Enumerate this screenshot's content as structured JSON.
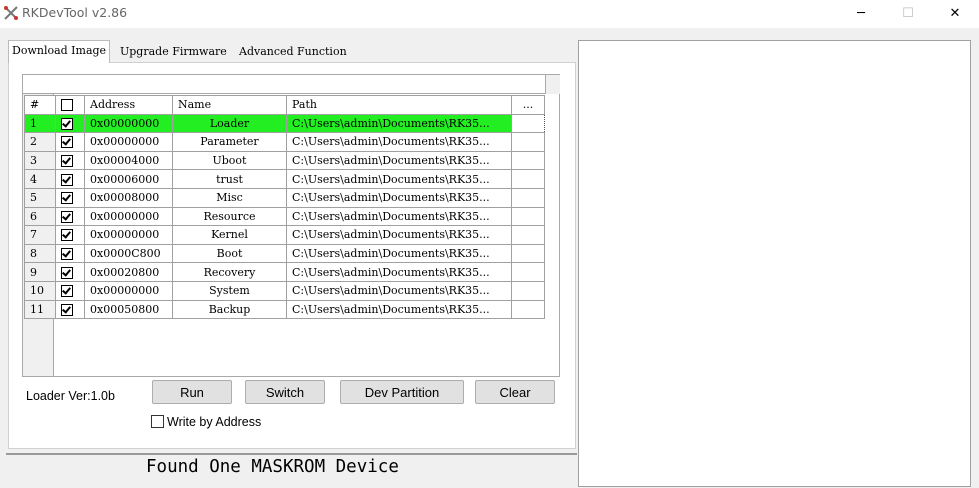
{
  "window": {
    "title": "RKDevTool v2.86",
    "icon": "rk-tool-icon",
    "controls": {
      "minimize": "─",
      "maximize": "☐",
      "close": "✕"
    }
  },
  "tabs": [
    {
      "label": "Download Image",
      "active": true
    },
    {
      "label": "Upgrade Firmware",
      "active": false
    },
    {
      "label": "Advanced Function",
      "active": false
    }
  ],
  "table": {
    "headers": {
      "num": "#",
      "check": "",
      "address": "Address",
      "name": "Name",
      "path": "Path",
      "extra": "..."
    },
    "rows": [
      {
        "num": "1",
        "checked": true,
        "address": "0x00000000",
        "name": "Loader",
        "path": "C:\\Users\\admin\\Documents\\RK35...",
        "selected": true
      },
      {
        "num": "2",
        "checked": true,
        "address": "0x00000000",
        "name": "Parameter",
        "path": "C:\\Users\\admin\\Documents\\RK35..."
      },
      {
        "num": "3",
        "checked": true,
        "address": "0x00004000",
        "name": "Uboot",
        "path": "C:\\Users\\admin\\Documents\\RK35..."
      },
      {
        "num": "4",
        "checked": true,
        "address": "0x00006000",
        "name": "trust",
        "path": "C:\\Users\\admin\\Documents\\RK35..."
      },
      {
        "num": "5",
        "checked": true,
        "address": "0x00008000",
        "name": "Misc",
        "path": "C:\\Users\\admin\\Documents\\RK35..."
      },
      {
        "num": "6",
        "checked": true,
        "address": "0x00000000",
        "name": "Resource",
        "path": "C:\\Users\\admin\\Documents\\RK35..."
      },
      {
        "num": "7",
        "checked": true,
        "address": "0x00000000",
        "name": "Kernel",
        "path": "C:\\Users\\admin\\Documents\\RK35..."
      },
      {
        "num": "8",
        "checked": true,
        "address": "0x0000C800",
        "name": "Boot",
        "path": "C:\\Users\\admin\\Documents\\RK35..."
      },
      {
        "num": "9",
        "checked": true,
        "address": "0x00020800",
        "name": "Recovery",
        "path": "C:\\Users\\admin\\Documents\\RK35..."
      },
      {
        "num": "10",
        "checked": true,
        "address": "0x00000000",
        "name": "System",
        "path": "C:\\Users\\admin\\Documents\\RK35..."
      },
      {
        "num": "11",
        "checked": true,
        "address": "0x00050800",
        "name": "Backup",
        "path": "C:\\Users\\admin\\Documents\\RK35..."
      }
    ]
  },
  "loader_version": "Loader Ver:1.0b",
  "buttons": {
    "run": "Run",
    "switch": "Switch",
    "dev_partition": "Dev Partition",
    "clear": "Clear"
  },
  "write_by_address": {
    "label": "Write by Address",
    "checked": false
  },
  "status": "Found One MASKROM Device",
  "colors": {
    "selected_row": "#22ee22"
  }
}
